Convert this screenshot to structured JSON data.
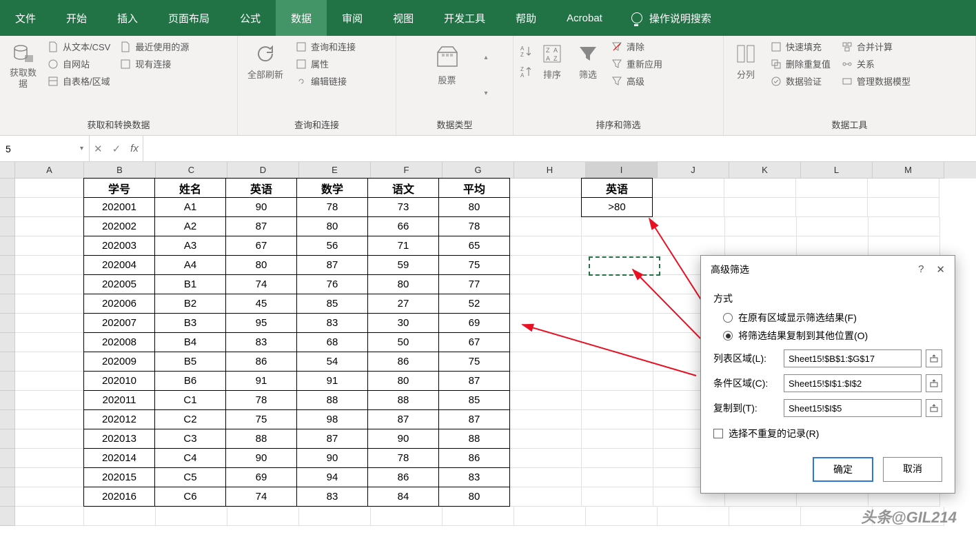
{
  "tabs": [
    "文件",
    "开始",
    "插入",
    "页面布局",
    "公式",
    "数据",
    "审阅",
    "视图",
    "开发工具",
    "帮助",
    "Acrobat"
  ],
  "active_tab_index": 5,
  "search_hint": "操作说明搜索",
  "ribbon_groups": {
    "get_transform": {
      "label": "获取和转换数据",
      "buttons": {
        "get_data": "获取数\n据",
        "from_csv": "从文本/CSV",
        "from_web": "自网站",
        "from_table": "自表格/区域",
        "recent": "最近使用的源",
        "existing": "现有连接"
      }
    },
    "queries": {
      "label": "查询和连接",
      "buttons": {
        "refresh_all": "全部刷新",
        "queries_conn": "查询和连接",
        "properties": "属性",
        "edit_links": "编辑链接"
      }
    },
    "data_types": {
      "label": "数据类型",
      "buttons": {
        "stocks": "股票"
      }
    },
    "sort_filter": {
      "label": "排序和筛选",
      "buttons": {
        "sort": "排序",
        "filter": "筛选",
        "clear": "清除",
        "reapply": "重新应用",
        "advanced": "高级"
      }
    },
    "data_tools": {
      "label": "数据工具",
      "buttons": {
        "text_to_cols": "分列",
        "flash_fill": "快速填充",
        "remove_dup": "删除重复值",
        "validation": "数据验证",
        "consolidate": "合并计算",
        "relationships": "关系",
        "data_model": "管理数据模型"
      }
    }
  },
  "name_box": "5",
  "columns": [
    "A",
    "B",
    "C",
    "D",
    "E",
    "F",
    "G",
    "H",
    "I",
    "J",
    "K",
    "L",
    "M"
  ],
  "table": {
    "headers": [
      "学号",
      "姓名",
      "英语",
      "数学",
      "语文",
      "平均"
    ],
    "rows": [
      [
        "202001",
        "A1",
        "90",
        "78",
        "73",
        "80"
      ],
      [
        "202002",
        "A2",
        "87",
        "80",
        "66",
        "78"
      ],
      [
        "202003",
        "A3",
        "67",
        "56",
        "71",
        "65"
      ],
      [
        "202004",
        "A4",
        "80",
        "87",
        "59",
        "75"
      ],
      [
        "202005",
        "B1",
        "74",
        "76",
        "80",
        "77"
      ],
      [
        "202006",
        "B2",
        "45",
        "85",
        "27",
        "52"
      ],
      [
        "202007",
        "B3",
        "95",
        "83",
        "30",
        "69"
      ],
      [
        "202008",
        "B4",
        "83",
        "68",
        "50",
        "67"
      ],
      [
        "202009",
        "B5",
        "86",
        "54",
        "86",
        "75"
      ],
      [
        "202010",
        "B6",
        "91",
        "91",
        "80",
        "87"
      ],
      [
        "202011",
        "C1",
        "78",
        "88",
        "88",
        "85"
      ],
      [
        "202012",
        "C2",
        "75",
        "98",
        "87",
        "87"
      ],
      [
        "202013",
        "C3",
        "88",
        "87",
        "90",
        "88"
      ],
      [
        "202014",
        "C4",
        "90",
        "90",
        "78",
        "86"
      ],
      [
        "202015",
        "C5",
        "69",
        "94",
        "86",
        "83"
      ],
      [
        "202016",
        "C6",
        "74",
        "83",
        "84",
        "80"
      ]
    ]
  },
  "criteria": {
    "header": "英语",
    "value": ">80"
  },
  "dialog": {
    "title": "高级筛选",
    "mode_label": "方式",
    "radio1": "在原有区域显示筛选结果(F)",
    "radio2": "将筛选结果复制到其他位置(O)",
    "list_label": "列表区域(L):",
    "list_value": "Sheet15!$B$1:$G$17",
    "crit_label": "条件区域(C):",
    "crit_value": "Sheet15!$I$1:$I$2",
    "copy_label": "复制到(T):",
    "copy_value": "Sheet15!$I$5",
    "unique": "选择不重复的记录(R)",
    "ok": "确定",
    "cancel": "取消",
    "help": "?"
  },
  "watermark": "头条@GIL214"
}
